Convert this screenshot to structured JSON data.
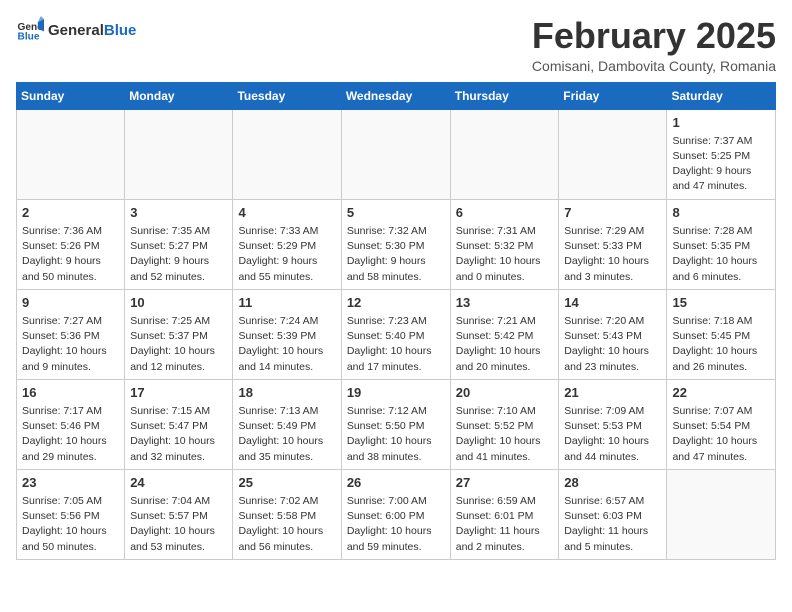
{
  "header": {
    "logo_general": "General",
    "logo_blue": "Blue",
    "month_title": "February 2025",
    "location": "Comisani, Dambovita County, Romania"
  },
  "weekdays": [
    "Sunday",
    "Monday",
    "Tuesday",
    "Wednesday",
    "Thursday",
    "Friday",
    "Saturday"
  ],
  "weeks": [
    [
      {
        "day": "",
        "info": ""
      },
      {
        "day": "",
        "info": ""
      },
      {
        "day": "",
        "info": ""
      },
      {
        "day": "",
        "info": ""
      },
      {
        "day": "",
        "info": ""
      },
      {
        "day": "",
        "info": ""
      },
      {
        "day": "1",
        "info": "Sunrise: 7:37 AM\nSunset: 5:25 PM\nDaylight: 9 hours and 47 minutes."
      }
    ],
    [
      {
        "day": "2",
        "info": "Sunrise: 7:36 AM\nSunset: 5:26 PM\nDaylight: 9 hours and 50 minutes."
      },
      {
        "day": "3",
        "info": "Sunrise: 7:35 AM\nSunset: 5:27 PM\nDaylight: 9 hours and 52 minutes."
      },
      {
        "day": "4",
        "info": "Sunrise: 7:33 AM\nSunset: 5:29 PM\nDaylight: 9 hours and 55 minutes."
      },
      {
        "day": "5",
        "info": "Sunrise: 7:32 AM\nSunset: 5:30 PM\nDaylight: 9 hours and 58 minutes."
      },
      {
        "day": "6",
        "info": "Sunrise: 7:31 AM\nSunset: 5:32 PM\nDaylight: 10 hours and 0 minutes."
      },
      {
        "day": "7",
        "info": "Sunrise: 7:29 AM\nSunset: 5:33 PM\nDaylight: 10 hours and 3 minutes."
      },
      {
        "day": "8",
        "info": "Sunrise: 7:28 AM\nSunset: 5:35 PM\nDaylight: 10 hours and 6 minutes."
      }
    ],
    [
      {
        "day": "9",
        "info": "Sunrise: 7:27 AM\nSunset: 5:36 PM\nDaylight: 10 hours and 9 minutes."
      },
      {
        "day": "10",
        "info": "Sunrise: 7:25 AM\nSunset: 5:37 PM\nDaylight: 10 hours and 12 minutes."
      },
      {
        "day": "11",
        "info": "Sunrise: 7:24 AM\nSunset: 5:39 PM\nDaylight: 10 hours and 14 minutes."
      },
      {
        "day": "12",
        "info": "Sunrise: 7:23 AM\nSunset: 5:40 PM\nDaylight: 10 hours and 17 minutes."
      },
      {
        "day": "13",
        "info": "Sunrise: 7:21 AM\nSunset: 5:42 PM\nDaylight: 10 hours and 20 minutes."
      },
      {
        "day": "14",
        "info": "Sunrise: 7:20 AM\nSunset: 5:43 PM\nDaylight: 10 hours and 23 minutes."
      },
      {
        "day": "15",
        "info": "Sunrise: 7:18 AM\nSunset: 5:45 PM\nDaylight: 10 hours and 26 minutes."
      }
    ],
    [
      {
        "day": "16",
        "info": "Sunrise: 7:17 AM\nSunset: 5:46 PM\nDaylight: 10 hours and 29 minutes."
      },
      {
        "day": "17",
        "info": "Sunrise: 7:15 AM\nSunset: 5:47 PM\nDaylight: 10 hours and 32 minutes."
      },
      {
        "day": "18",
        "info": "Sunrise: 7:13 AM\nSunset: 5:49 PM\nDaylight: 10 hours and 35 minutes."
      },
      {
        "day": "19",
        "info": "Sunrise: 7:12 AM\nSunset: 5:50 PM\nDaylight: 10 hours and 38 minutes."
      },
      {
        "day": "20",
        "info": "Sunrise: 7:10 AM\nSunset: 5:52 PM\nDaylight: 10 hours and 41 minutes."
      },
      {
        "day": "21",
        "info": "Sunrise: 7:09 AM\nSunset: 5:53 PM\nDaylight: 10 hours and 44 minutes."
      },
      {
        "day": "22",
        "info": "Sunrise: 7:07 AM\nSunset: 5:54 PM\nDaylight: 10 hours and 47 minutes."
      }
    ],
    [
      {
        "day": "23",
        "info": "Sunrise: 7:05 AM\nSunset: 5:56 PM\nDaylight: 10 hours and 50 minutes."
      },
      {
        "day": "24",
        "info": "Sunrise: 7:04 AM\nSunset: 5:57 PM\nDaylight: 10 hours and 53 minutes."
      },
      {
        "day": "25",
        "info": "Sunrise: 7:02 AM\nSunset: 5:58 PM\nDaylight: 10 hours and 56 minutes."
      },
      {
        "day": "26",
        "info": "Sunrise: 7:00 AM\nSunset: 6:00 PM\nDaylight: 10 hours and 59 minutes."
      },
      {
        "day": "27",
        "info": "Sunrise: 6:59 AM\nSunset: 6:01 PM\nDaylight: 11 hours and 2 minutes."
      },
      {
        "day": "28",
        "info": "Sunrise: 6:57 AM\nSunset: 6:03 PM\nDaylight: 11 hours and 5 minutes."
      },
      {
        "day": "",
        "info": ""
      }
    ]
  ]
}
